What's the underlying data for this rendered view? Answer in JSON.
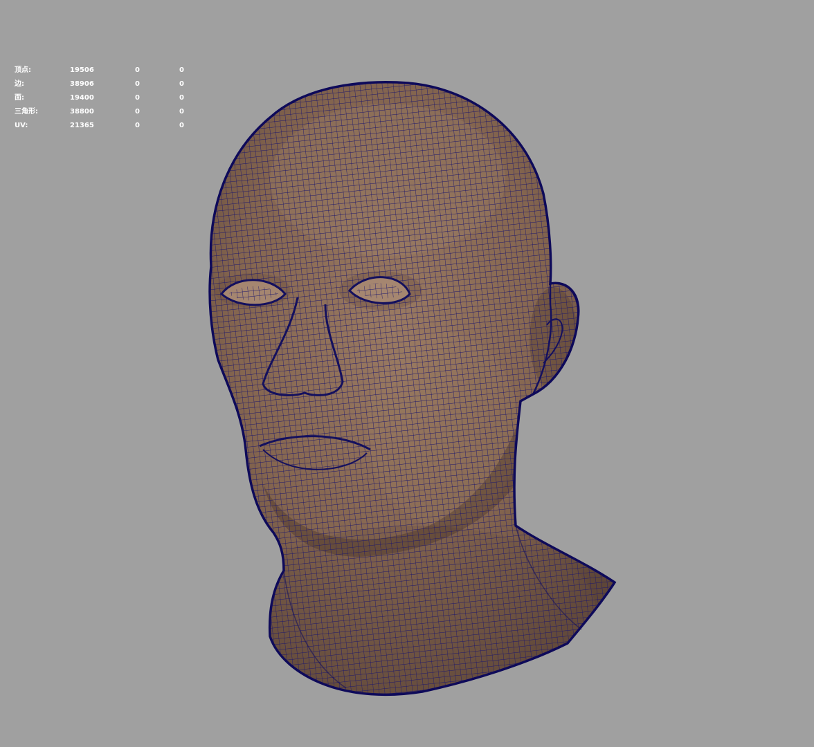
{
  "viewport": {
    "background": "#a0a0a0",
    "mesh_color": "#8a6a52",
    "wire_color": "#14105e"
  },
  "hud": {
    "rows": [
      {
        "label": "顶点:",
        "total": "19506",
        "selected": "0",
        "component": "0"
      },
      {
        "label": "边:",
        "total": "38906",
        "selected": "0",
        "component": "0"
      },
      {
        "label": "面:",
        "total": "19400",
        "selected": "0",
        "component": "0"
      },
      {
        "label": "三角形:",
        "total": "38800",
        "selected": "0",
        "component": "0"
      },
      {
        "label": "UV:",
        "total": "21365",
        "selected": "0",
        "component": "0"
      }
    ]
  }
}
